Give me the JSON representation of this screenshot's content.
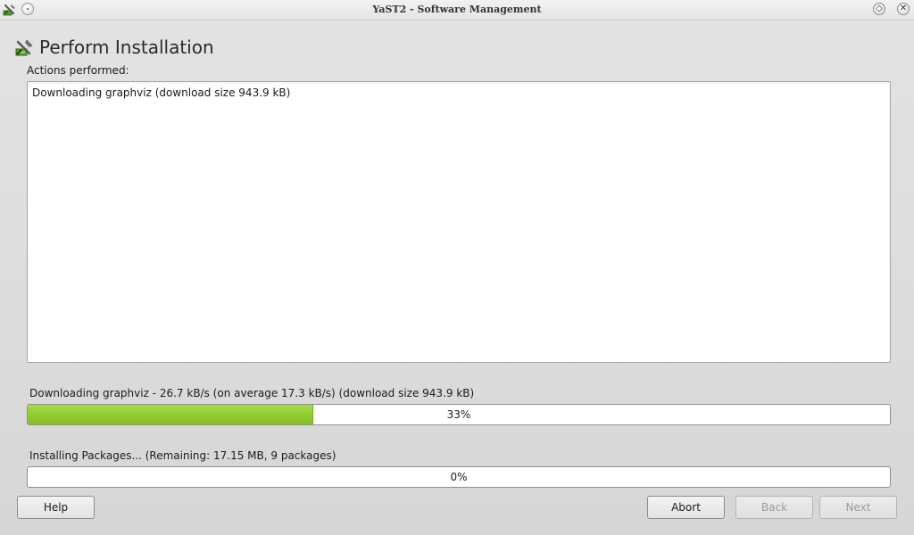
{
  "window": {
    "title": "YaST2 - Software Management"
  },
  "heading": {
    "title": "Perform Installation",
    "icon": "yast-software-icon"
  },
  "log": {
    "label": "Actions performed:",
    "lines": [
      "Downloading graphviz (download size 943.9 kB)"
    ]
  },
  "download_progress": {
    "label": "Downloading graphviz - 26.7 kB/s (on average 17.3 kB/s) (download size 943.9 kB)",
    "percent": 33,
    "percent_text": "33%"
  },
  "install_progress": {
    "label": "Installing Packages... (Remaining: 17.15 MB, 9 packages)",
    "percent": 0,
    "percent_text": "0%"
  },
  "buttons": {
    "help": "Help",
    "abort": "Abort",
    "back": "Back",
    "next": "Next"
  },
  "colors": {
    "progress_fill": "#94d23a",
    "accent_green": "#84c024"
  }
}
